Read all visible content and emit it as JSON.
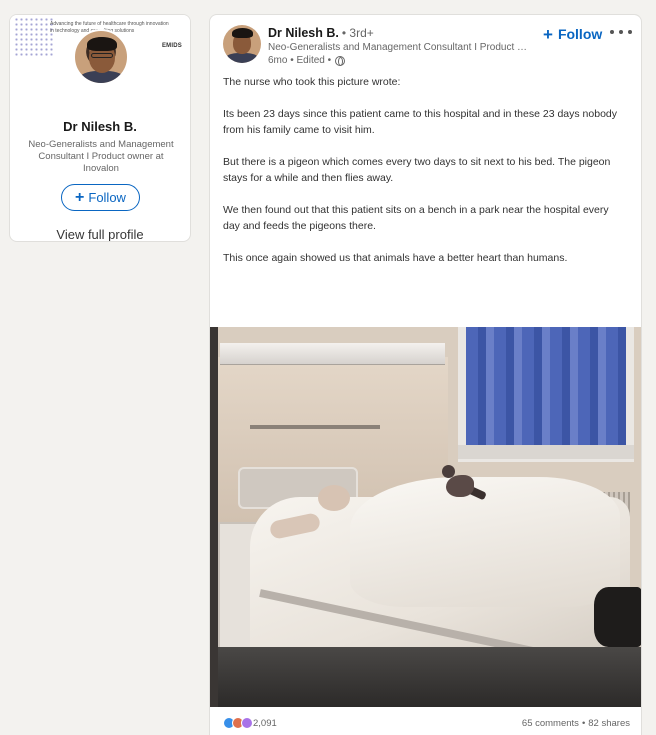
{
  "profile_card": {
    "banner_text": "Advancing the future of healthcare through innovation in technology and consulting solutions",
    "banner_logo": "EMIDS",
    "name": "Dr Nilesh B.",
    "headline": "Neo-Generalists and Management Consultant I Product owner at Inovalon",
    "follow_label": "Follow",
    "view_profile_label": "View full profile"
  },
  "post": {
    "author_name": "Dr Nilesh B.",
    "author_degree": "• 3rd+",
    "author_headline": "Neo-Generalists and Management Consultant I Product ow...",
    "meta_time": "6mo • Edited •",
    "follow_label": "Follow",
    "paragraphs": [
      "The nurse who took this picture wrote:",
      "Its been 23 days since this patient came to this hospital and in these 23 days nobody from his family came to visit him.",
      "But there is a pigeon which comes every two days to sit next to his bed. The pigeon stays for a while and then flies away.",
      "We then found out that this patient sits on a bench in a park near the hospital every day and feeds the pigeons there.",
      "This once again showed us that animals have a better heart than humans."
    ],
    "image_alt": "Hospital patient lying in bed with a pigeon perched on the blanket",
    "reaction_count": "2,091",
    "comments": "65 comments",
    "separator": "•",
    "shares": "82 shares"
  },
  "icons": {
    "follow_plus": "plus-icon",
    "more": "more-icon",
    "visibility": "globe-icon",
    "reactions": [
      "like-icon",
      "love-icon",
      "insight-icon"
    ]
  },
  "colors": {
    "accent": "#0a66c2",
    "page_bg": "#f3f2ef",
    "like": "#378fe9",
    "love": "#df704d",
    "insight": "#a872e8"
  }
}
